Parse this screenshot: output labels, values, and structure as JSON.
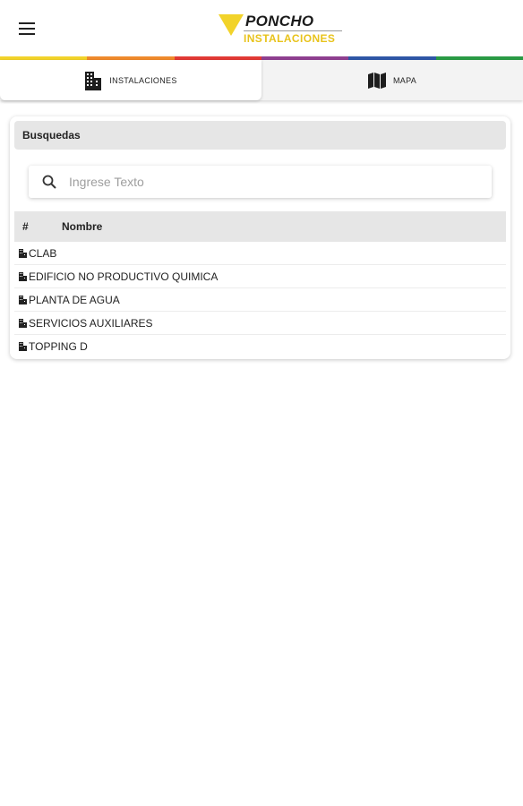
{
  "header": {
    "logo_top": "PONCHO",
    "logo_bottom": "INSTALACIONES",
    "brand_colors": [
      "#f2d32a",
      "#ef8a2c",
      "#e23a35",
      "#8e3f8f",
      "#2f56a6",
      "#2a9a45"
    ]
  },
  "tabs": [
    {
      "label": "INSTALACIONES",
      "icon": "building-icon",
      "active": true
    },
    {
      "label": "MAPA",
      "icon": "map-icon",
      "active": false
    }
  ],
  "search_panel": {
    "title": "Busquedas",
    "placeholder": "Ingrese Texto",
    "value": ""
  },
  "table": {
    "columns": [
      "#",
      "Nombre"
    ],
    "rows": [
      {
        "name": "CLAB"
      },
      {
        "name": "EDIFICIO NO PRODUCTIVO QUIMICA"
      },
      {
        "name": "PLANTA DE AGUA"
      },
      {
        "name": "SERVICIOS AUXILIARES"
      },
      {
        "name": "TOPPING D"
      }
    ]
  }
}
